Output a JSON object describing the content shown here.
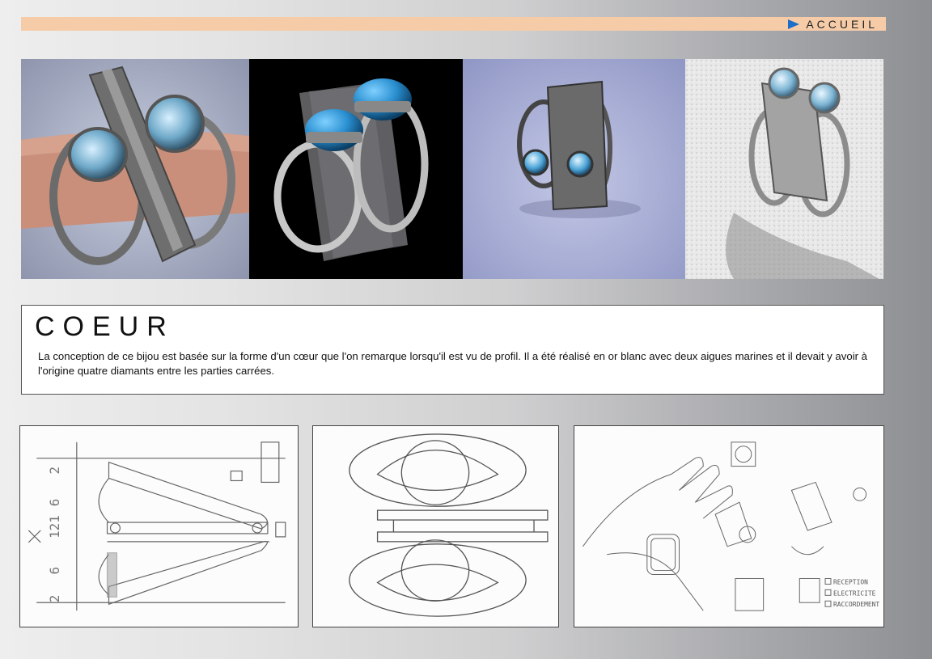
{
  "nav": {
    "accueil_label": "ACCUEIL"
  },
  "content": {
    "title": "COEUR",
    "description": "La conception de ce bijou est basée sur la forme d'un cœur que l'on remarque lorsqu'il est vu de profil. Il a été réalisé en or blanc avec deux aigues marines et il devait y avoir à l'origine quatre diamants entre les parties carrées."
  },
  "sketch3": {
    "labels": [
      "RECEPTION",
      "ELECTRICITE",
      "RACCORDEMENT"
    ]
  },
  "colors": {
    "topbar": "#f6cca8",
    "arrow": "#1d6ec8",
    "stone": "#2a8fd0"
  }
}
